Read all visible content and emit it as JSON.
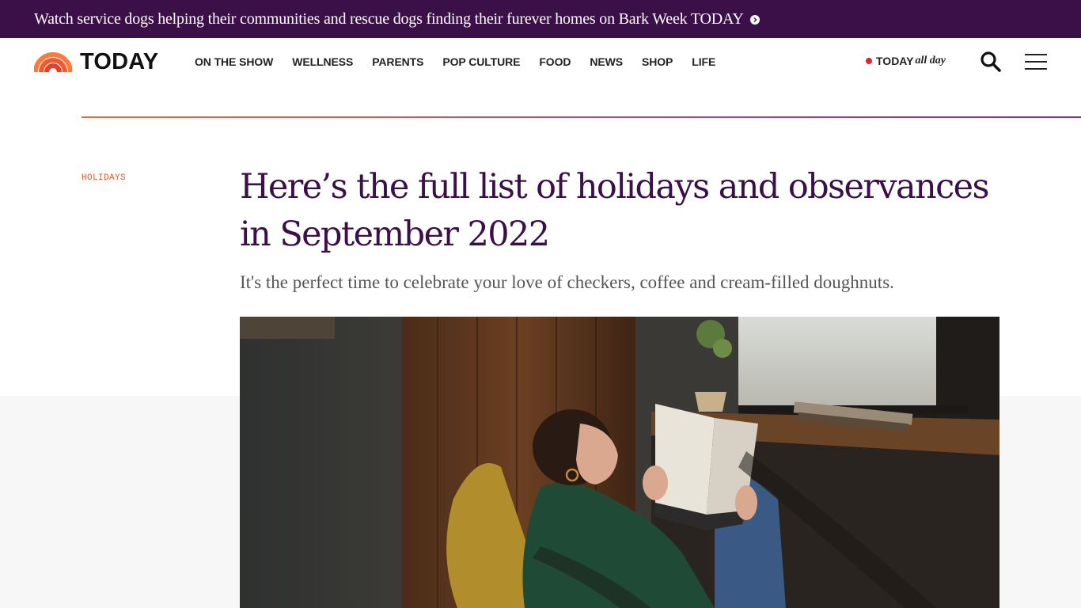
{
  "banner": {
    "text": "Watch service dogs helping their communities and rescue dogs finding their furever homes on Bark Week TODAY",
    "arrow_icon": "chevron-right-icon",
    "background": "#3b1048"
  },
  "header": {
    "logo_text": "TODAY",
    "logo_icon": "rainbow-icon",
    "nav": [
      {
        "label": "ON THE SHOW"
      },
      {
        "label": "WELLNESS"
      },
      {
        "label": "PARENTS"
      },
      {
        "label": "POP CULTURE"
      },
      {
        "label": "FOOD"
      },
      {
        "label": "NEWS"
      },
      {
        "label": "SHOP"
      },
      {
        "label": "LIFE"
      }
    ],
    "all_day": {
      "today": "TODAY",
      "suffix": "all day",
      "live_dot_color": "#e2202f"
    },
    "search_icon": "search-icon",
    "menu_icon": "hamburger-menu-icon"
  },
  "article": {
    "section": "HOLIDAYS",
    "headline": "Here’s the full list of holidays and observances in September 2022",
    "dek": "It's the perfect time to celebrate your love of checkers, coffee and cream-filled doughnuts.",
    "hero_image": "woman-reading-book-in-cafe-photo"
  },
  "colors": {
    "brand_purple": "#3b1048",
    "accent_orange": "#e2562f",
    "divider_start": "#f26b3a",
    "divider_end": "#8c2a9c"
  }
}
